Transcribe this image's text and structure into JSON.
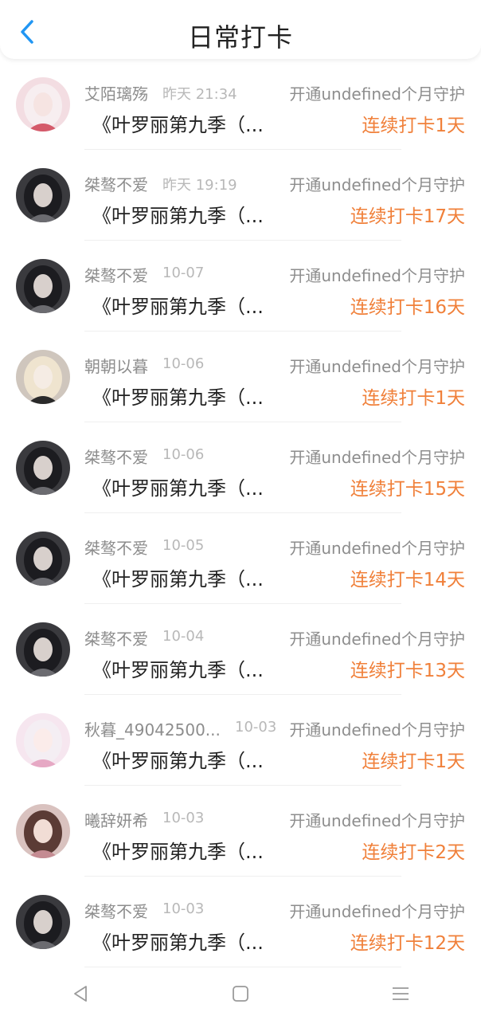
{
  "header": {
    "title": "日常打卡",
    "back_icon": "chevron-left-icon",
    "accent_color": "#2196f3"
  },
  "entries": [
    {
      "name": "艾陌璃殇",
      "time": "昨天 21:34",
      "guard": "开通undefined个月守护",
      "work": "《叶罗丽第九季（...",
      "streak": "连续打卡1天",
      "avatar": "pink-girl"
    },
    {
      "name": "桀骜不爱",
      "time": "昨天 19:19",
      "guard": "开通undefined个月守护",
      "work": "《叶罗丽第九季（...",
      "streak": "连续打卡17天",
      "avatar": "dark-girl"
    },
    {
      "name": "桀骜不爱",
      "time": "10-07",
      "guard": "开通undefined个月守护",
      "work": "《叶罗丽第九季（...",
      "streak": "连续打卡16天",
      "avatar": "dark-girl"
    },
    {
      "name": "朝朝以暮",
      "time": "10-06",
      "guard": "开通undefined个月守护",
      "work": "《叶罗丽第九季（...",
      "streak": "连续打卡1天",
      "avatar": "blonde-girl"
    },
    {
      "name": "桀骜不爱",
      "time": "10-06",
      "guard": "开通undefined个月守护",
      "work": "《叶罗丽第九季（...",
      "streak": "连续打卡15天",
      "avatar": "dark-girl"
    },
    {
      "name": "桀骜不爱",
      "time": "10-05",
      "guard": "开通undefined个月守护",
      "work": "《叶罗丽第九季（...",
      "streak": "连续打卡14天",
      "avatar": "dark-girl"
    },
    {
      "name": "桀骜不爱",
      "time": "10-04",
      "guard": "开通undefined个月守护",
      "work": "《叶罗丽第九季（...",
      "streak": "连续打卡13天",
      "avatar": "dark-girl"
    },
    {
      "name": "秋暮_49042500...",
      "time": "10-03",
      "guard": "开通undefined个月守护",
      "work": "《叶罗丽第九季（...",
      "streak": "连续打卡1天",
      "avatar": "pastel-girl"
    },
    {
      "name": "曦辞妍希",
      "time": "10-03",
      "guard": "开通undefined个月守护",
      "work": "《叶罗丽第九季（...",
      "streak": "连续打卡2天",
      "avatar": "brown-girl"
    },
    {
      "name": "桀骜不爱",
      "time": "10-03",
      "guard": "开通undefined个月守护",
      "work": "《叶罗丽第九季（...",
      "streak": "连续打卡12天",
      "avatar": "dark-girl"
    }
  ],
  "navbar": {
    "icons": [
      "back-triangle-icon",
      "home-square-icon",
      "menu-lines-icon"
    ]
  },
  "colors": {
    "streak": "#f0803a",
    "muted_text": "#8d8d8d",
    "time_text": "#b8b8b8"
  }
}
